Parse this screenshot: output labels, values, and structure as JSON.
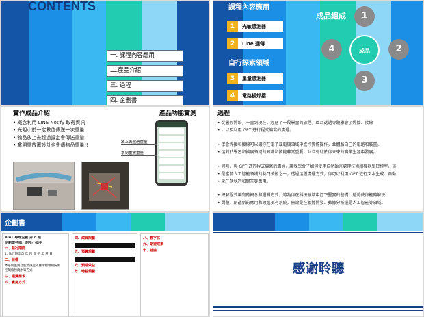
{
  "slide1": {
    "title": "CONTENTS",
    "items": [
      "一.  課程內容應用",
      "二.產品介紹",
      "三.  過程",
      "四.  企劃書"
    ]
  },
  "slide2": {
    "heading1": "課程內容應用",
    "heading2": "自行探索領域",
    "heading3": "成品組成",
    "course": [
      {
        "num": "1",
        "label": "光敏感測器"
      },
      {
        "num": "2",
        "label": "Line 通傳"
      }
    ],
    "explore": [
      {
        "num": "3",
        "label": "重量感測器"
      },
      {
        "num": "4",
        "label": "電路板焊接"
      }
    ],
    "center": "成品",
    "nodes": [
      "1",
      "2",
      "3",
      "4"
    ]
  },
  "slide3": {
    "title_left": "實作成品介紹",
    "title_right": "產品功能實測",
    "bullets": [
      "•  概念利用 LINE Notify 取得資訊",
      "•  光阻小於一定數值傳送一次重量",
      "•  物品放上去超過設定會傳送重量",
      "•  拿開重放還設計也會傳物品重量!!"
    ],
    "tags": [
      "放上去超過重量",
      "拿到重放重量"
    ]
  },
  "slide4": {
    "title": "過程",
    "p1": [
      "•  從暑假開始，一直到現在，經歷了一段學習的旅程，並且透過專題學會了焊接、接線",
      "•  ，以及利用 GPT 進行程式編寫的溝通。"
    ],
    "p2": [
      "•  學會焊接和接線可以讓你在電子或電機領域中進行實際操作，並體驗自己的電路和裝置。",
      "•  這對於學習和擴展領域的知識和技能非常重要，並且有助於你未來的職業生涯中發展。"
    ],
    "p3": [
      "•  同時，與 GPT 進行程式編寫的溝通，讓我學會了如何使用自然語言處理技術和機器學習模型，這",
      "•  是當前人工智能領域的熱門技術之一，透過這種溝通方式，你可以利用 GPT 進行文本生成、自動",
      "•  化任務執行和問答等應用。"
    ],
    "p4": [
      "•  總解程式編寫的概念和邏輯方式，將為你在科技領域中打下堅實的基礎，這將使你能夠解決",
      "•  問題、創造新的應用和改進現有系統，無論是在軟體開發、數據分析還是人工智能等領域。"
    ]
  },
  "slide5": {
    "title": "企劃書",
    "col1": [
      "AIoT 專題企劃 第 8 組",
      "企劃案名稱：廁所小助手",
      "一、執行期間",
      "1. 執行期間自 年 月 日 至 年 月 日",
      "二、目標",
      "本系統主要功能為讓主人應用物聯網技術",
      "控制植物澆水等方式",
      "三、經費需求",
      "四、實施方式"
    ],
    "col2": [
      "四、成員規劃",
      "五、預算規劃",
      "六、預期效益",
      "七、時程規劃"
    ],
    "col3": [
      "八、數字化",
      "九、期望成果",
      "十、結論"
    ]
  },
  "slide6": {
    "thanks": "感谢聆聽"
  }
}
